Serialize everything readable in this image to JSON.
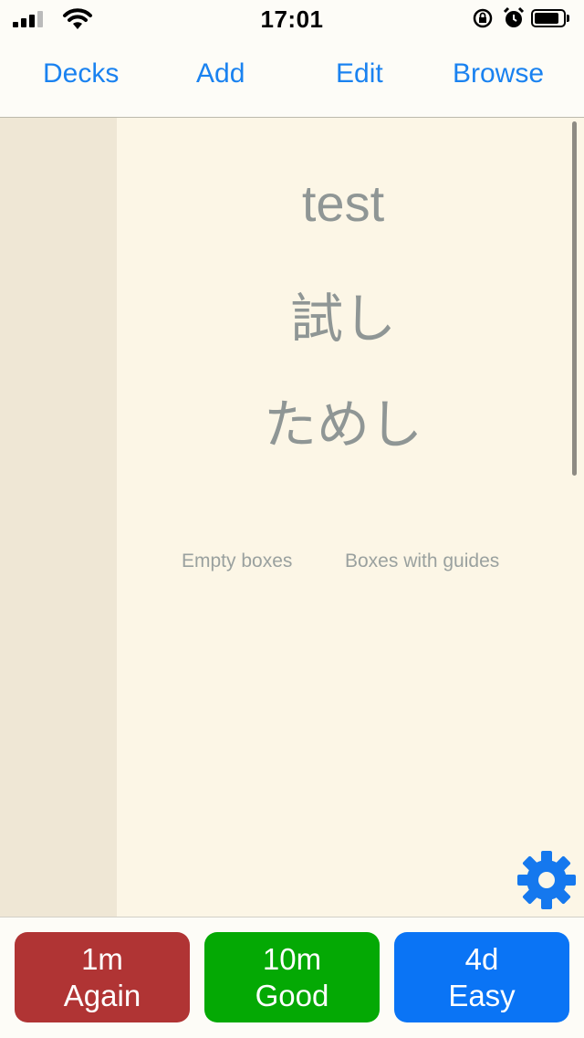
{
  "status_bar": {
    "time": "17:01",
    "icons": [
      "signal-icon",
      "wifi-icon",
      "orientation-lock-icon",
      "alarm-icon",
      "battery-icon"
    ]
  },
  "nav": {
    "decks": "Decks",
    "add": "Add",
    "edit": "Edit",
    "browse": "Browse"
  },
  "card": {
    "word": "test",
    "kanji": "試し",
    "kana": "ためし"
  },
  "links": {
    "empty_boxes": "Empty boxes",
    "boxes_with_guides": "Boxes with guides"
  },
  "settings": {
    "icon": "gear-icon"
  },
  "answers": {
    "again": {
      "interval": "1m",
      "label": "Again",
      "color": "#b03434"
    },
    "good": {
      "interval": "10m",
      "label": "Good",
      "color": "#04a904"
    },
    "easy": {
      "interval": "4d",
      "label": "Easy",
      "color": "#0a74f5"
    }
  },
  "colors": {
    "accent": "#1a82f0",
    "card_background": "#fcf6e6",
    "side_panel": "#efe7d5",
    "card_text": "#8f9695"
  }
}
